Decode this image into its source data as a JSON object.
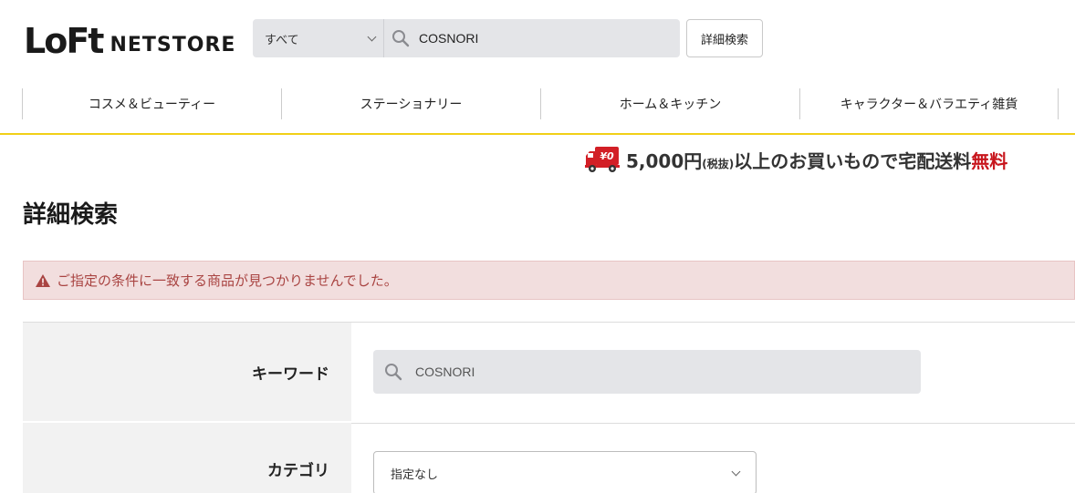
{
  "header": {
    "logo_main": "LoFt",
    "logo_sub": "NETSTORE",
    "search": {
      "category": "すべて",
      "value": "COSNORI"
    },
    "advanced_search_label": "詳細検索"
  },
  "nav": {
    "items": [
      {
        "label": "コスメ＆ビューティー"
      },
      {
        "label": "ステーショナリー"
      },
      {
        "label": "ホーム＆キッチン"
      },
      {
        "label": "キャラクター＆バラエティ雑貨"
      }
    ],
    "rule_color": "#f1cf17"
  },
  "shipping_banner": {
    "badge": "¥0",
    "amount": "5,000円",
    "tax_note": "(税抜)",
    "middle": "以上のお買いもので宅配送料",
    "free": "無料",
    "free_color": "#c8161d"
  },
  "page": {
    "title": "詳細検索"
  },
  "alert": {
    "message": "ご指定の条件に一致する商品が見つかりませんでした。",
    "color": "#a94442"
  },
  "form": {
    "keyword": {
      "label": "キーワード",
      "value": "COSNORI"
    },
    "category": {
      "label": "カテゴリ",
      "selected": "指定なし"
    }
  }
}
